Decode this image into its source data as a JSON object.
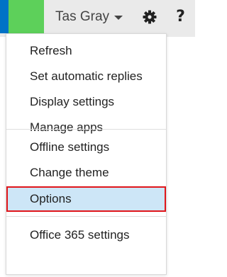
{
  "header": {
    "user_name": "Tas Gray",
    "icons": [
      "caret-down-icon",
      "gear-icon",
      "help-icon"
    ],
    "help_glyph": "?",
    "colors": {
      "strip": "#0072c6",
      "tile": "#5dd05a",
      "bar": "#eaeaea"
    }
  },
  "menu": {
    "items": [
      {
        "label": "Refresh"
      },
      {
        "label": "Set automatic replies"
      },
      {
        "label": "Display settings"
      },
      {
        "label": "Manage apps"
      },
      {
        "label": "Offline settings"
      },
      {
        "label": "Change theme"
      },
      {
        "label": "Options",
        "selected": true
      },
      {
        "label": "Office 365 settings"
      }
    ],
    "colors": {
      "selected_bg": "#cde6f7",
      "highlight_border": "#e0161b"
    }
  }
}
